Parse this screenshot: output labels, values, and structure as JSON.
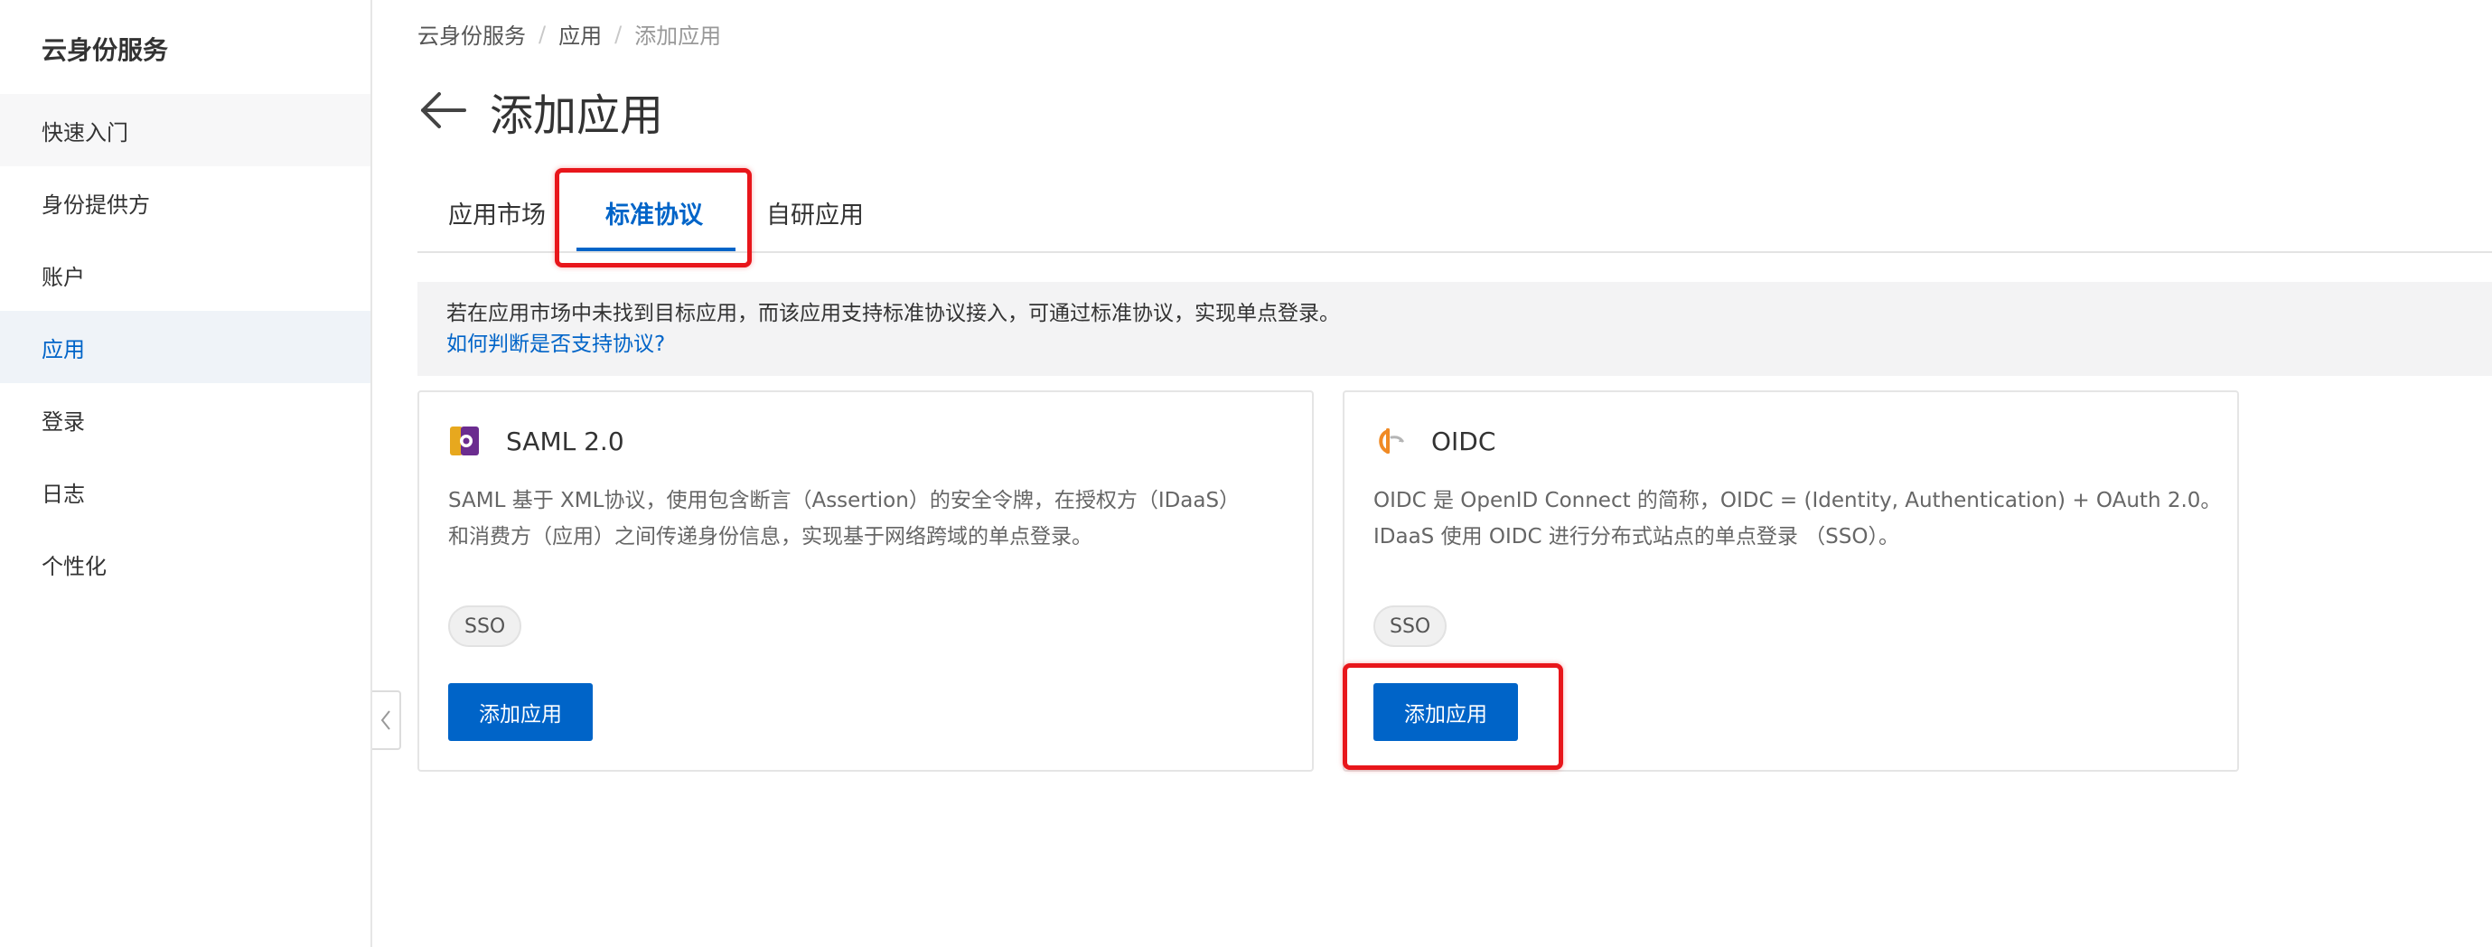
{
  "sidebar": {
    "title": "云身份服务",
    "items": [
      {
        "label": "快速入门"
      },
      {
        "label": "身份提供方"
      },
      {
        "label": "账户"
      },
      {
        "label": "应用"
      },
      {
        "label": "登录"
      },
      {
        "label": "日志"
      },
      {
        "label": "个性化"
      }
    ],
    "active_index": 3
  },
  "breadcrumb": {
    "items": [
      "云身份服务",
      "应用",
      "添加应用"
    ],
    "separator": "/"
  },
  "header": {
    "title": "添加应用",
    "back_icon": "arrow-left-icon"
  },
  "tabs": [
    {
      "label": "应用市场"
    },
    {
      "label": "标准协议"
    },
    {
      "label": "自研应用"
    }
  ],
  "active_tab": "标准协议",
  "notice": {
    "text": "若在应用市场中未找到目标应用，而该应用支持标准协议接入，可通过标准协议，实现单点登录。",
    "link": "如何判断是否支持协议?"
  },
  "cards": [
    {
      "title": "SAML 2.0",
      "logo": "saml-logo-icon",
      "desc_line1": "SAML 基于 XML协议，使用包含断言（Assertion）的安全令牌，在授权方（IDaaS）",
      "desc_line2": "和消费方（应用）之间传递身份信息，实现基于网络跨域的单点登录。",
      "tag": "SSO",
      "button": "添加应用"
    },
    {
      "title": "OIDC",
      "logo": "oidc-logo-icon",
      "desc_line1": "OIDC 是 OpenID Connect 的简称，OIDC = (Identity, Authentication) + OAuth 2.0。",
      "desc_line2": "IDaaS 使用 OIDC 进行分布式站点的单点登录 （SSO）。",
      "tag": "SSO",
      "button": "添加应用"
    }
  ],
  "colors": {
    "accent": "#0064c8",
    "highlight": "#e8161b",
    "active_nav_bg": "#eff3f8"
  }
}
